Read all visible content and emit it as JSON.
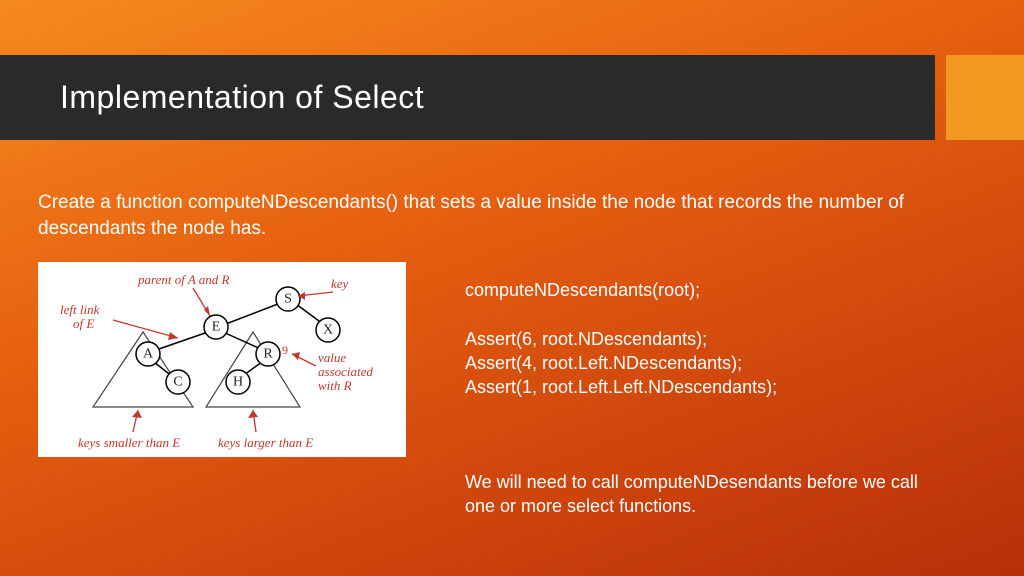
{
  "title": "Implementation of Select",
  "intro": "Create a function computeNDescendants() that sets a value inside the node that records the number of descendants the node has.",
  "code": "computeNDescendants(root);\n\nAssert(6, root.NDescendants);\nAssert(4, root.Left.NDescendants);\nAssert(1, root.Left.Left.NDescendants);",
  "note": "We will need to call computeNDesendants before we call one or more select functions.",
  "diagram": {
    "labels": {
      "parent": "parent of A and R",
      "key": "key",
      "leftlink1": "left link",
      "leftlink2": "of E",
      "value1": "value",
      "value2": "associated",
      "value3": "with R",
      "smaller": "keys smaller than E",
      "larger": "keys larger than E"
    },
    "nodes": {
      "S": "S",
      "E": "E",
      "X": "X",
      "A": "A",
      "R": "R",
      "C": "C",
      "H": "H",
      "Rval": "9"
    }
  }
}
